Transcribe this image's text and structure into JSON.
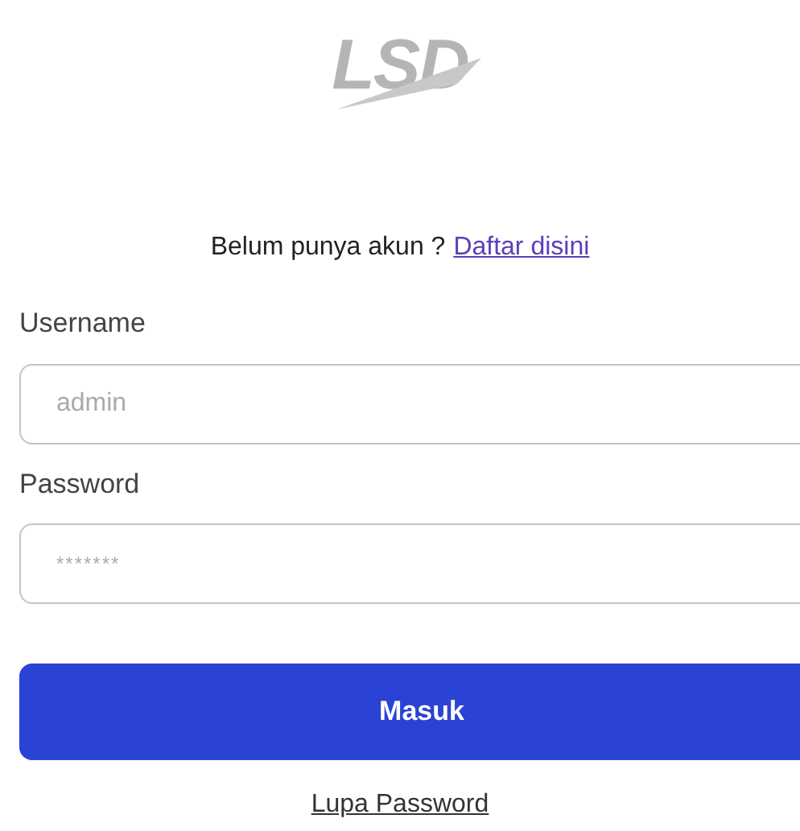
{
  "logo": {
    "text": "LSD"
  },
  "signup_prompt": {
    "text": "Belum punya akun ?",
    "link": "Daftar disini"
  },
  "fields": [
    {
      "label": "Username",
      "placeholder": "admin",
      "kind": "text"
    },
    {
      "label": "Password",
      "placeholder": "*******",
      "kind": "password"
    }
  ],
  "submit_button": "Masuk",
  "forgot_link": "Lupa Password"
}
